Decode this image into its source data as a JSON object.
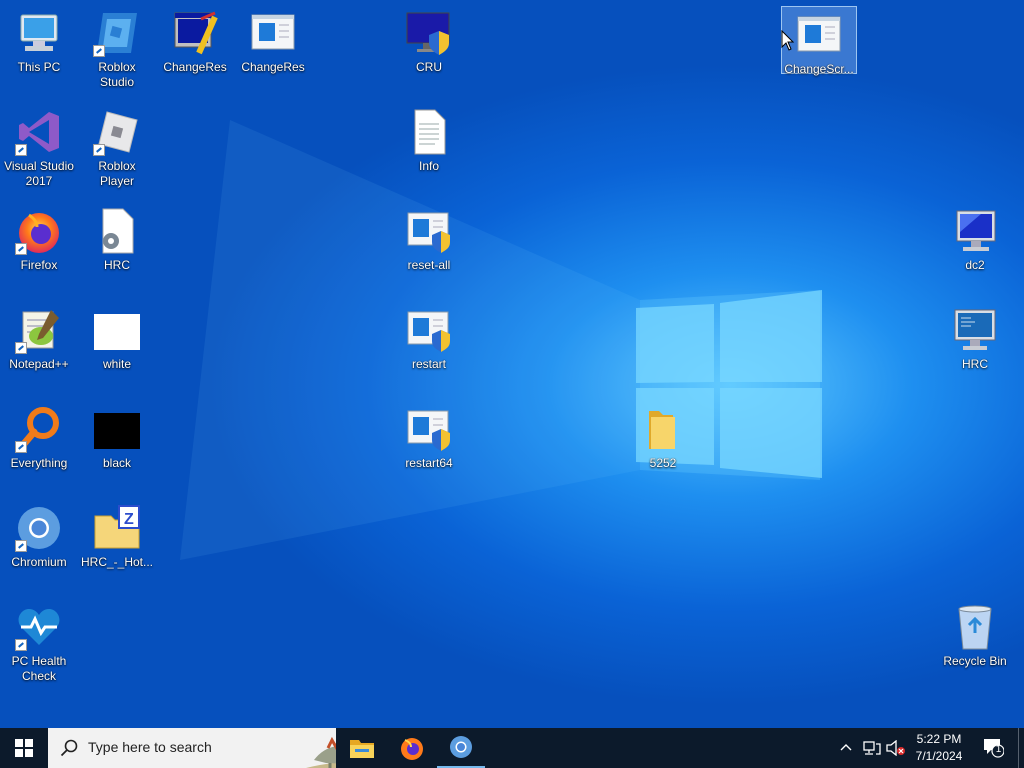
{
  "desktop": {
    "icons": [
      {
        "label": "This PC",
        "icon": "computer-icon"
      },
      {
        "label": "Roblox Studio",
        "icon": "roblox-studio-icon"
      },
      {
        "label": "ChangeRes",
        "icon": "changeres-app-icon"
      },
      {
        "label": "ChangeRes",
        "icon": "window-icon"
      },
      {
        "label": "CRU",
        "icon": "monitor-shield-icon"
      },
      {
        "label": "ChangeScr...",
        "icon": "window-icon"
      },
      {
        "label": "Visual Studio 2017",
        "icon": "visual-studio-icon"
      },
      {
        "label": "Roblox Player",
        "icon": "roblox-player-icon"
      },
      {
        "label": "Info",
        "icon": "text-file-icon"
      },
      {
        "label": "Firefox",
        "icon": "firefox-icon"
      },
      {
        "label": "HRC",
        "icon": "settings-file-icon"
      },
      {
        "label": "reset-all",
        "icon": "window-shield-icon"
      },
      {
        "label": "dc2",
        "icon": "monitor-icon"
      },
      {
        "label": "Notepad++",
        "icon": "notepadpp-icon"
      },
      {
        "label": "white",
        "icon": "white-image-icon"
      },
      {
        "label": "restart",
        "icon": "window-shield-icon"
      },
      {
        "label": "HRC",
        "icon": "monitor-app-icon"
      },
      {
        "label": "Everything",
        "icon": "everything-search-icon"
      },
      {
        "label": "black",
        "icon": "black-image-icon"
      },
      {
        "label": "restart64",
        "icon": "window-shield-icon"
      },
      {
        "label": "5252",
        "icon": "folder-icon"
      },
      {
        "label": "Chromium",
        "icon": "chromium-icon"
      },
      {
        "label": "HRC_-_Hot...",
        "icon": "zip-folder-icon"
      },
      {
        "label": "PC Health Check",
        "icon": "pc-health-icon"
      },
      {
        "label": "Recycle Bin",
        "icon": "recycle-bin-icon"
      }
    ]
  },
  "taskbar": {
    "start_icon": "windows-logo-icon",
    "search_placeholder": "Type here to search",
    "pinned": [
      "file-explorer-icon",
      "firefox-icon",
      "chromium-icon"
    ],
    "time": "5:22 PM",
    "date": "7/1/2024",
    "notification_count": "1"
  }
}
